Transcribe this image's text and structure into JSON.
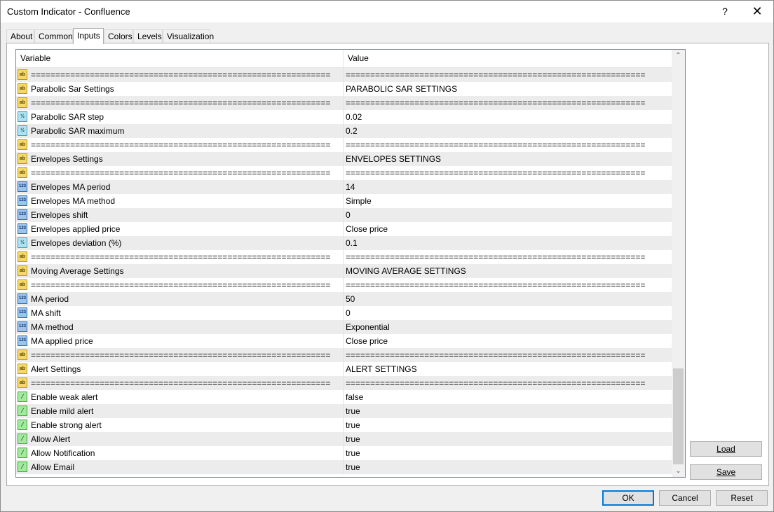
{
  "window": {
    "title": "Custom Indicator - Confluence",
    "help": "?",
    "close": "✕"
  },
  "tabs": [
    "About",
    "Common",
    "Inputs",
    "Colors",
    "Levels",
    "Visualization"
  ],
  "active_tab": "Inputs",
  "grid": {
    "headers": {
      "variable": "Variable",
      "value": "Value"
    },
    "rows": [
      {
        "type": "ab",
        "var": "=============================================================",
        "val": "============================================================="
      },
      {
        "type": "ab",
        "var": "Parabolic Sar Settings",
        "val": "PARABOLIC SAR SETTINGS"
      },
      {
        "type": "ab",
        "var": "=============================================================",
        "val": "============================================================="
      },
      {
        "type": "dbl",
        "var": "Parabolic SAR step",
        "val": "0.02"
      },
      {
        "type": "dbl",
        "var": "Parabolic SAR maximum",
        "val": "0.2"
      },
      {
        "type": "ab",
        "var": "=============================================================",
        "val": "============================================================="
      },
      {
        "type": "ab",
        "var": "Envelopes Settings",
        "val": "ENVELOPES SETTINGS"
      },
      {
        "type": "ab",
        "var": "=============================================================",
        "val": "============================================================="
      },
      {
        "type": "int",
        "var": "Envelopes MA period",
        "val": "14"
      },
      {
        "type": "int",
        "var": "Envelopes MA method",
        "val": "Simple"
      },
      {
        "type": "int",
        "var": "Envelopes shift",
        "val": "0"
      },
      {
        "type": "int",
        "var": "Envelopes applied price",
        "val": "Close price"
      },
      {
        "type": "dbl",
        "var": "Envelopes deviation (%)",
        "val": "0.1"
      },
      {
        "type": "ab",
        "var": "=============================================================",
        "val": "============================================================="
      },
      {
        "type": "ab",
        "var": "Moving Average Settings",
        "val": "MOVING AVERAGE SETTINGS"
      },
      {
        "type": "ab",
        "var": "=============================================================",
        "val": "============================================================="
      },
      {
        "type": "int",
        "var": "MA period",
        "val": "50"
      },
      {
        "type": "int",
        "var": "MA shift",
        "val": "0"
      },
      {
        "type": "int",
        "var": "MA method",
        "val": "Exponential"
      },
      {
        "type": "int",
        "var": "MA applied price",
        "val": "Close price"
      },
      {
        "type": "ab",
        "var": "=============================================================",
        "val": "============================================================="
      },
      {
        "type": "ab",
        "var": "Alert Settings",
        "val": "ALERT SETTINGS"
      },
      {
        "type": "ab",
        "var": "=============================================================",
        "val": "============================================================="
      },
      {
        "type": "bool",
        "var": "Enable weak alert",
        "val": "false"
      },
      {
        "type": "bool",
        "var": "Enable mild alert",
        "val": "true"
      },
      {
        "type": "bool",
        "var": "Enable strong alert",
        "val": "true"
      },
      {
        "type": "bool",
        "var": "Allow Alert",
        "val": "true"
      },
      {
        "type": "bool",
        "var": "Allow Notification",
        "val": "true"
      },
      {
        "type": "bool",
        "var": "Allow Email",
        "val": "true"
      }
    ]
  },
  "icon_glyphs": {
    "ab": "ab",
    "dbl": "½",
    "int": "123",
    "bool": "⁄"
  },
  "icon_names": {
    "ab": "string-type-icon",
    "dbl": "double-type-icon",
    "int": "integer-type-icon",
    "bool": "boolean-type-icon"
  },
  "side_buttons": {
    "load": "Load",
    "save": "Save"
  },
  "footer_buttons": {
    "ok": "OK",
    "cancel": "Cancel",
    "reset": "Reset"
  },
  "scroll": {
    "up": "⌃",
    "down": "⌄"
  },
  "colors": {
    "default_button_border": "#0078d7",
    "odd_row": "#ececec"
  }
}
